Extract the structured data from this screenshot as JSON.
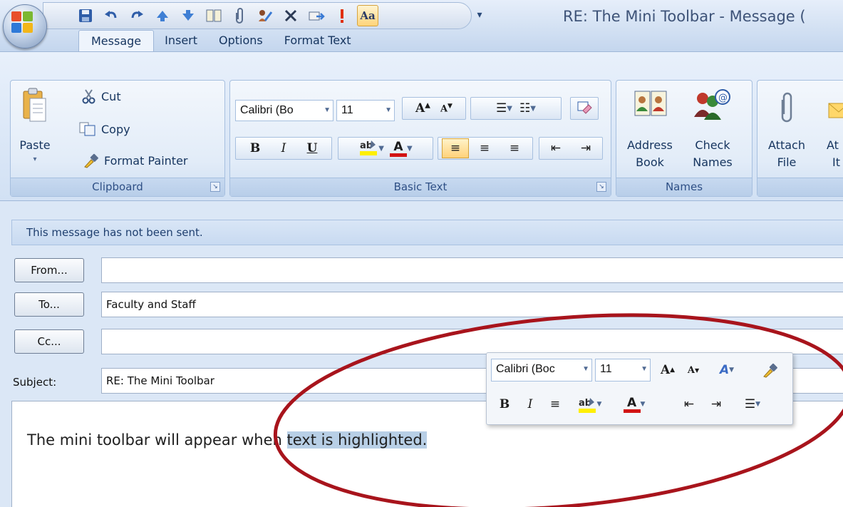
{
  "window": {
    "title": "RE: The Mini Toolbar - Message (",
    "tabs": [
      {
        "label": "Message",
        "active": true
      },
      {
        "label": "Insert",
        "active": false
      },
      {
        "label": "Options",
        "active": false
      },
      {
        "label": "Format Text",
        "active": false
      }
    ],
    "quick_access": [
      "save-icon",
      "undo-icon",
      "redo-icon",
      "previous-item-icon",
      "next-item-icon",
      "address-book-icon",
      "paperclip-icon",
      "signature-icon",
      "delete-icon",
      "forward-icon",
      "importance-icon",
      "format-text-icon",
      "customize-dropdown-icon"
    ],
    "format_text_glyph": "Aa"
  },
  "ribbon": {
    "clipboard": {
      "label": "Clipboard",
      "paste": "Paste",
      "cut": "Cut",
      "copy": "Copy",
      "format_painter": "Format Painter"
    },
    "basic_text": {
      "label": "Basic Text",
      "font": "Calibri (Bo",
      "size": "11",
      "bold": "B",
      "italic": "I",
      "underline": "U",
      "grow": "A",
      "shrink": "A",
      "font_color": "A"
    },
    "names": {
      "label": "Names",
      "address_book_line1": "Address",
      "address_book_line2": "Book",
      "check_names_line1": "Check",
      "check_names_line2": "Names"
    },
    "include": {
      "attach_file_line1": "Attach",
      "attach_file_line2": "File",
      "attach_item_line1": "At",
      "attach_item_line2": "It"
    }
  },
  "message": {
    "info": "This message has not been sent.",
    "from_button": "From...",
    "from_value": "",
    "to_button": "To...",
    "to_value": "Faculty and Staff",
    "cc_button": "Cc...",
    "cc_value": "",
    "subject_label": "Subject:",
    "subject_value": "RE: The Mini Toolbar",
    "body_plain": "The mini toolbar will appear when ",
    "body_highlighted": "text is highlighted."
  },
  "mini_toolbar": {
    "font": "Calibri (Boc",
    "size": "11",
    "grow": "A",
    "shrink": "A",
    "styles": "A",
    "bold": "B",
    "italic": "I",
    "font_color": "A"
  },
  "colors": {
    "annotation": "#a8141c",
    "highlight_yellow": "#ffef00",
    "font_red": "#d21414",
    "selection": "#b8cfe6"
  }
}
